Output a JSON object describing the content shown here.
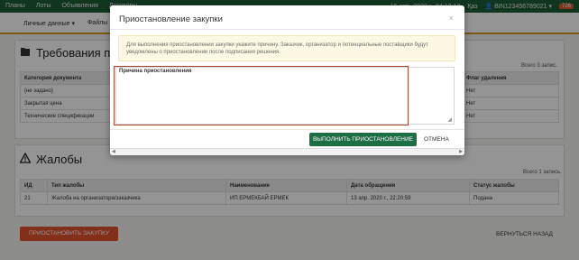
{
  "topbar": {
    "nav": [
      "Планы",
      "Лоты",
      "Объявления",
      "Договоры"
    ],
    "date": "15 апр. 2020 г., 04:13:18",
    "lang": "Қаз",
    "user": "BIN123456789021",
    "badge": "726"
  },
  "subnav": {
    "items": [
      "Личные данные ▾",
      "Файлы"
    ]
  },
  "requirements": {
    "title": "Требования по ло",
    "total": "Всего 3 запис.",
    "columns": [
      "Категория документа",
      "Флаг удаления"
    ],
    "rows": [
      [
        "(не задано)",
        "Нет"
      ],
      [
        "Закрытая цена",
        "Нет"
      ],
      [
        "Технические спецификации",
        "Нет"
      ]
    ]
  },
  "complaints": {
    "title": "Жалобы",
    "total": "Всего 1 запись.",
    "columns": [
      "ИД",
      "Тип жалобы",
      "Наименование",
      "Дата обращения",
      "Статус жалобы"
    ],
    "rows": [
      [
        "21",
        "Жалоба на организатора/заказчика",
        "ИП ЕРМЕКБАЙ ЕРМЕК",
        "13 апр. 2020 г., 22:20:59",
        "Подана"
      ]
    ]
  },
  "actions": {
    "suspend": "ПРИОСТАНОВИТЬ ЗАКУПКУ",
    "back": "ВЕРНУТЬСЯ НАЗАД"
  },
  "modal": {
    "title": "Приостановление закупки",
    "close": "×",
    "alert": "Для выполнения приостановлении закупки укажите причину. Заказчик, организатор и потенциальные поставщики будут уведомлены о приостановлении после подписания решения.",
    "field_label": "Причина приостановления",
    "submit": "ВЫПОЛНИТЬ ПРИОСТАНОВЛЕНИЕ",
    "cancel": "ОТМЕНА"
  }
}
